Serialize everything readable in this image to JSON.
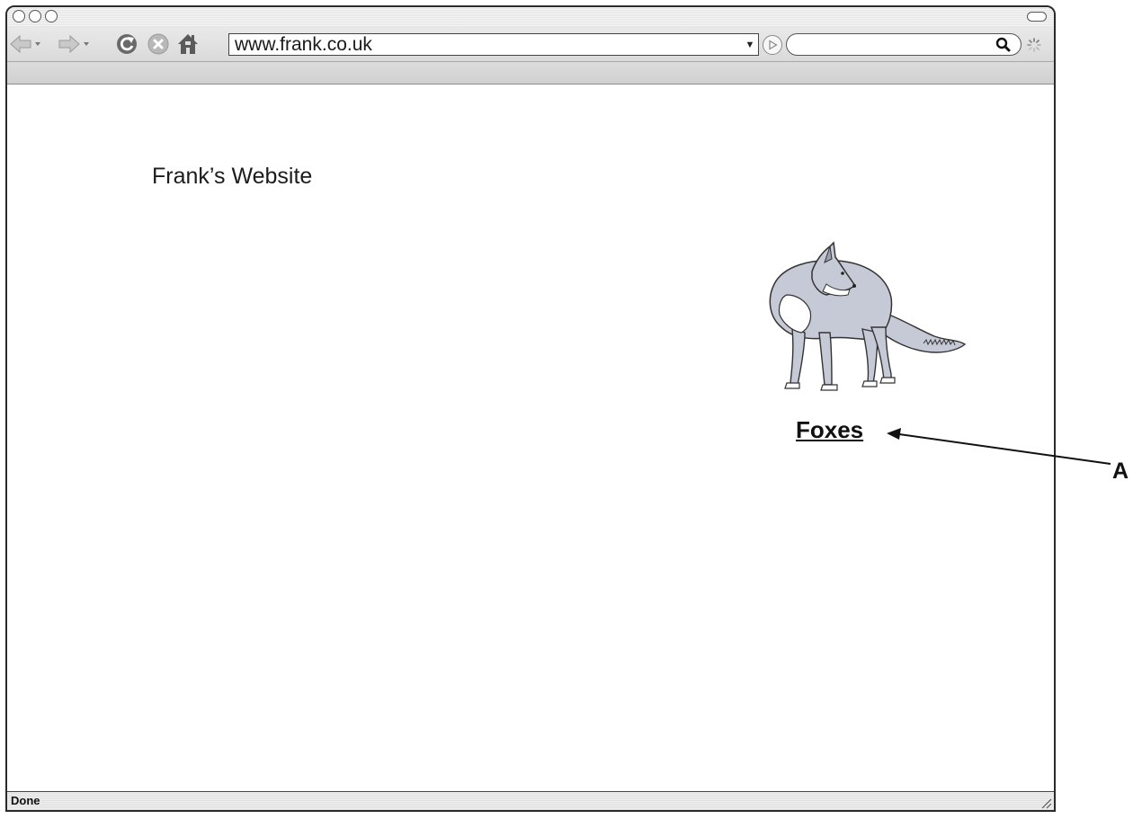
{
  "browser": {
    "url": "www.frank.co.uk",
    "search_value": "",
    "status": "Done"
  },
  "toolbar": {
    "back_icon": "back-arrow-icon",
    "forward_icon": "forward-arrow-icon",
    "reload_icon": "reload-icon",
    "stop_icon": "stop-icon",
    "home_icon": "home-icon"
  },
  "page": {
    "title": "Frank’s Website",
    "image": "fox-illustration",
    "link_label": "Foxes"
  },
  "annotation": {
    "label": "A"
  }
}
